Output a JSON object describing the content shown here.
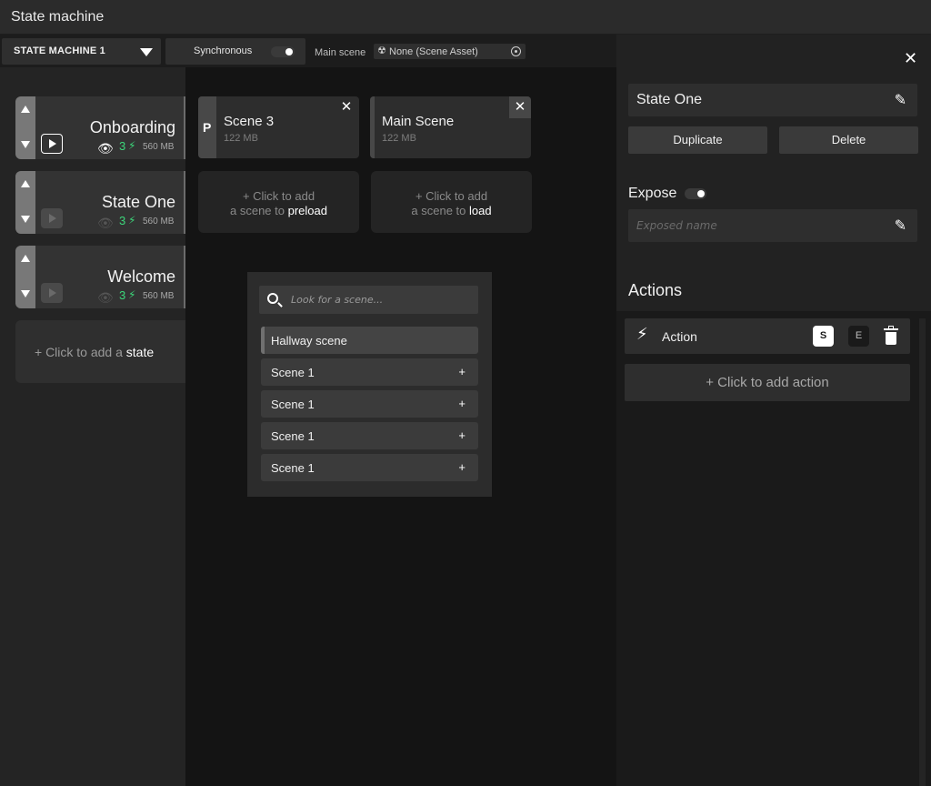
{
  "window": {
    "title": "State machine"
  },
  "toolbar": {
    "state_machine_label": "STATE MACHINE 1",
    "sync_label": "Synchronous",
    "main_scene_label": "Main scene",
    "main_scene_value": "None (Scene Asset)"
  },
  "states": [
    {
      "name": "Onboarding",
      "count": "3",
      "size": "560 MB"
    },
    {
      "name": "State One",
      "count": "3",
      "size": "560 MB"
    },
    {
      "name": "Welcome",
      "count": "3",
      "size": "560 MB"
    }
  ],
  "add_state": {
    "prefix": "+  Click to add a ",
    "emph": "state"
  },
  "scenes": [
    {
      "badge": "P",
      "name": "Scene 3",
      "size": "122 MB"
    },
    {
      "name": "Main Scene",
      "size": "122 MB"
    }
  ],
  "add_scene": {
    "preload": {
      "line1": "+  Click to add",
      "line2_prefix": "a scene to ",
      "emph": "preload"
    },
    "load": {
      "line1": "+  Click to add",
      "line2_prefix": "a scene to ",
      "emph": "load"
    }
  },
  "picker": {
    "search_placeholder": "Look for a scene...",
    "items": [
      {
        "label": "Hallway scene"
      },
      {
        "label": "Scene 1",
        "action": "+"
      },
      {
        "label": "Scene 1",
        "action": "+"
      },
      {
        "label": "Scene 1",
        "action": "+"
      },
      {
        "label": "Scene 1",
        "action": "+"
      }
    ]
  },
  "inspector": {
    "state_name": "State One",
    "duplicate_label": "Duplicate",
    "delete_label": "Delete",
    "expose_label": "Expose",
    "exposed_name_placeholder": "Exposed name",
    "actions_label": "Actions",
    "actions": [
      {
        "label": "Action",
        "s_label": "S",
        "e_label": "E"
      }
    ],
    "add_action_label": "+ Click to add action"
  },
  "colors": {
    "accent_green": "#3cd67a",
    "panel_dark": "#141414",
    "panel": "#242424",
    "card": "#333333"
  },
  "icons": {
    "dropdown": "chevron-down-icon",
    "close": "close-icon",
    "edit": "pencil-icon",
    "search": "search-icon",
    "play": "play-icon",
    "visibility": "eye-icon",
    "lightning": "bolt-icon",
    "delete": "trash-icon"
  }
}
